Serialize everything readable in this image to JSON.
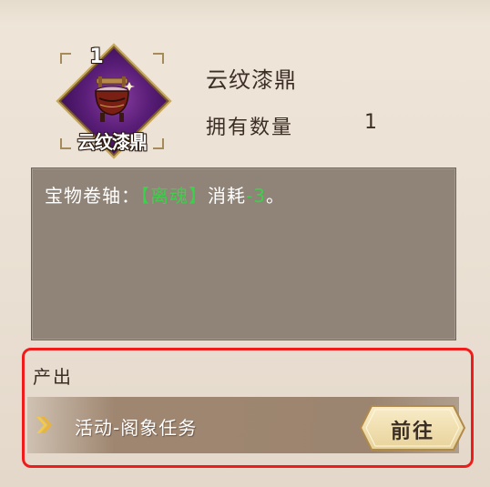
{
  "item": {
    "count": "1",
    "icon_label": "云纹漆鼎",
    "name": "云纹漆鼎",
    "owned_label": "拥有数量",
    "owned_value": "1"
  },
  "description": {
    "prefix": "宝物卷轴：",
    "highlight_name": "【离魂】",
    "middle": "消耗",
    "highlight_value": "-3",
    "suffix": "。"
  },
  "source": {
    "title": "产出",
    "entry_text": "活动-阁象任务",
    "go_label": "前往"
  },
  "colors": {
    "highlight_green": "#3bd14a",
    "frame_purple": "#5a1e78",
    "selection_red": "#f01c1c",
    "button_gold": "#f3e3b6"
  },
  "icons": [
    "cauldron-icon",
    "chevron-right-icon"
  ]
}
